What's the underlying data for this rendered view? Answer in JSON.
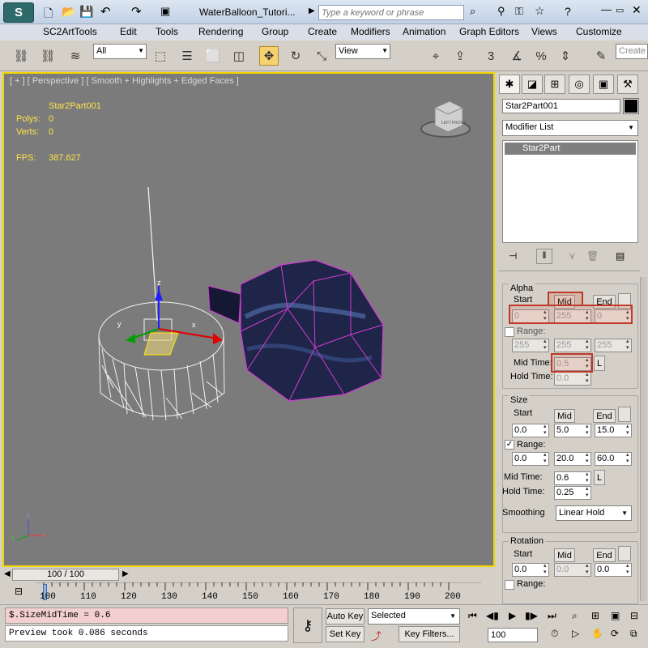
{
  "title": {
    "filename": "WaterBalloon_Tutori...",
    "search_placeholder": "Type a keyword or phrase",
    "app_icon": "3ds-max-logo-icon"
  },
  "menu": [
    "SC2ArtTools",
    "Edit",
    "Tools",
    "Rendering",
    "Group",
    "Create",
    "Modifiers",
    "Animation",
    "Graph Editors",
    "Views",
    "Customize"
  ],
  "toolbar": {
    "selection_filter": "All",
    "ref_coord": "View",
    "snap_label": "3",
    "create_label": "Create"
  },
  "viewport": {
    "label": "[ + ] [ Perspective ] [ Smooth + Highlights + Edged Faces ]",
    "object_name": "Star2Part001",
    "polys_label": "Polys:",
    "polys_value": "0",
    "verts_label": "Verts:",
    "verts_value": "0",
    "fps_label": "FPS:",
    "fps_value": "387.627",
    "gizmo_z": "z",
    "gizmo_y": "y",
    "gizmo_x": "x",
    "viewcube_front": "FRONT",
    "viewcube_left": "LEFT",
    "axis_z": "z",
    "axis_y": "y",
    "axis_x": "x"
  },
  "panel": {
    "object_name": "Star2Part001",
    "object_color": "#000000",
    "modifier_list": "Modifier List",
    "stack_item": "Star2Part",
    "alpha": {
      "title": "Alpha",
      "start_label": "Start",
      "mid_label": "Mid",
      "end_label": "End",
      "start": "0",
      "mid": "255",
      "end": "0",
      "range_label": "Range:",
      "range_start": "255",
      "range_mid": "255",
      "range_end": "255",
      "mid_time_label": "Mid Time:",
      "mid_time": "0.5",
      "l_label": "L",
      "hold_time_label": "Hold Time:",
      "hold_time": "0.0"
    },
    "size": {
      "title": "Size",
      "start_label": "Start",
      "mid_label": "Mid",
      "end_label": "End",
      "start": "0.0",
      "mid": "5.0",
      "end": "15.0",
      "range_label": "Range:",
      "range_checked": true,
      "range_start": "0.0",
      "range_mid": "20.0",
      "range_end": "60.0",
      "mid_time_label": "Mid Time:",
      "mid_time": "0.6",
      "l_label": "L",
      "hold_time_label": "Hold Time:",
      "hold_time": "0.25",
      "smoothing_label": "Smoothing",
      "smoothing": "Linear Hold"
    },
    "rotation": {
      "title": "Rotation",
      "start_label": "Start",
      "mid_label": "Mid",
      "end_label": "End",
      "start": "0.0",
      "mid": "0.0",
      "end": "0.0",
      "range_label": "Range:"
    }
  },
  "timeline": {
    "slider": "100 / 100",
    "ticks": [
      "100",
      "110",
      "120",
      "130",
      "140",
      "150",
      "160",
      "170",
      "180",
      "190",
      "200"
    ]
  },
  "status": {
    "script_line": "$.SizeMidTime = 0.6",
    "prompt_line": "Preview took 0.086 seconds",
    "auto_key": "Auto Key",
    "set_key": "Set Key",
    "key_mode": "Selected",
    "key_filters": "Key Filters...",
    "frame": "100"
  }
}
